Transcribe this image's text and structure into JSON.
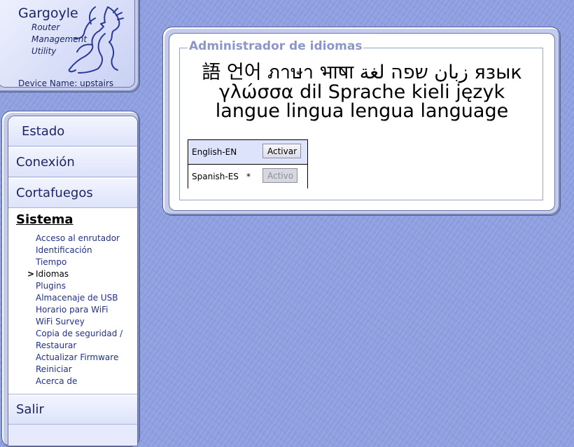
{
  "header": {
    "app_title": "Gargoyle",
    "tagline": [
      "Router",
      "Management",
      "Utility"
    ],
    "device_name": "Device Name: upstairs"
  },
  "nav": {
    "top_items": [
      "Estado",
      "Conexión",
      "Cortafuegos"
    ],
    "section_title": "Sistema",
    "sub_items": [
      "Acceso al enrutador",
      "Identificación",
      "Tiempo",
      "Idiomas",
      "Plugins",
      "Almacenaje de USB",
      "Horario para WiFi",
      "WiFi Survey",
      "Copia de seguridad /",
      "Restaurar",
      "Actualizar Firmware",
      "Reiniciar",
      "Acerca de"
    ],
    "active_marker": ">",
    "bottom_item": "Salir"
  },
  "main": {
    "legend": "Administrador de idiomas",
    "language_lines": [
      "語 언어 ภาษา भाषा زبان שפה لغة язык",
      "γλώσσα dil Sprache kieli język",
      "langue lingua lengua language"
    ],
    "languages": [
      {
        "name": "English-EN",
        "marker": "",
        "button": "Activar",
        "enabled": true
      },
      {
        "name": "Spanish-ES",
        "marker": "*",
        "button": "Activo",
        "enabled": false
      }
    ]
  },
  "colors": {
    "background": "#8e9fe0",
    "panel": "#c3cced",
    "legend": "#8d96c8",
    "nav_text": "#1c2566",
    "link": "#22308a"
  }
}
